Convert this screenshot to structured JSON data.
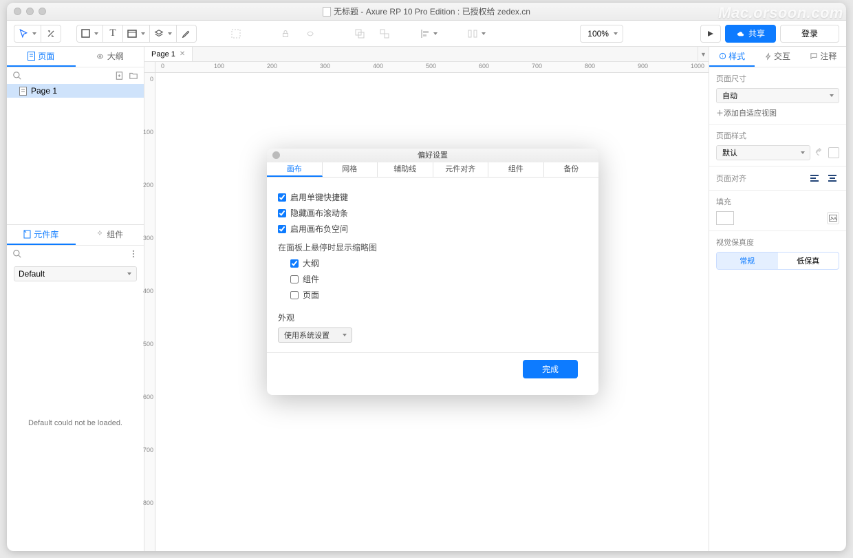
{
  "title": "无标题 - Axure RP 10 Pro Edition : 已授权给 zedex.cn",
  "watermark": "Mac.orsoon.com",
  "toolbar": {
    "zoom": "100%",
    "share": "共享",
    "login": "登录"
  },
  "leftPanel": {
    "tabs": {
      "pages": "页面",
      "outline": "大纲"
    },
    "tree": {
      "page1": "Page 1"
    },
    "libTabs": {
      "widgets": "元件库",
      "components": "组件"
    },
    "libSelect": "Default",
    "libError": "Default could not be loaded."
  },
  "docTab": "Page 1",
  "rightPanel": {
    "tabs": {
      "style": "样式",
      "interaction": "交互",
      "notes": "注释"
    },
    "pageSize": {
      "label": "页面尺寸",
      "value": "自动",
      "addView": "＋添加自适应视图"
    },
    "pageStyle": {
      "label": "页面样式",
      "value": "默认"
    },
    "align": {
      "label": "页面对齐"
    },
    "fill": {
      "label": "填充"
    },
    "fidelity": {
      "label": "视觉保真度",
      "normal": "常规",
      "low": "低保真"
    }
  },
  "modal": {
    "title": "偏好设置",
    "tabs": {
      "canvas": "画布",
      "grid": "网格",
      "guides": "辅助线",
      "snap": "元件对齐",
      "components": "组件",
      "backup": "备份"
    },
    "canvas": {
      "singleKey": "启用单键快捷键",
      "hideScroll": "隐藏画布滚动条",
      "negative": "启用画布负空间",
      "hoverLabel": "在面板上悬停时显示缩略图",
      "hoverOutline": "大纲",
      "hoverComponents": "组件",
      "hoverPages": "页面",
      "appearanceLabel": "外观",
      "appearanceValue": "使用系统设置"
    },
    "done": "完成"
  },
  "ruler": {
    "h": [
      "0",
      "100",
      "200",
      "300",
      "400",
      "500",
      "600",
      "700",
      "800",
      "900",
      "1000"
    ],
    "v": [
      "0",
      "100",
      "200",
      "300",
      "400",
      "500",
      "600",
      "700",
      "800"
    ]
  }
}
